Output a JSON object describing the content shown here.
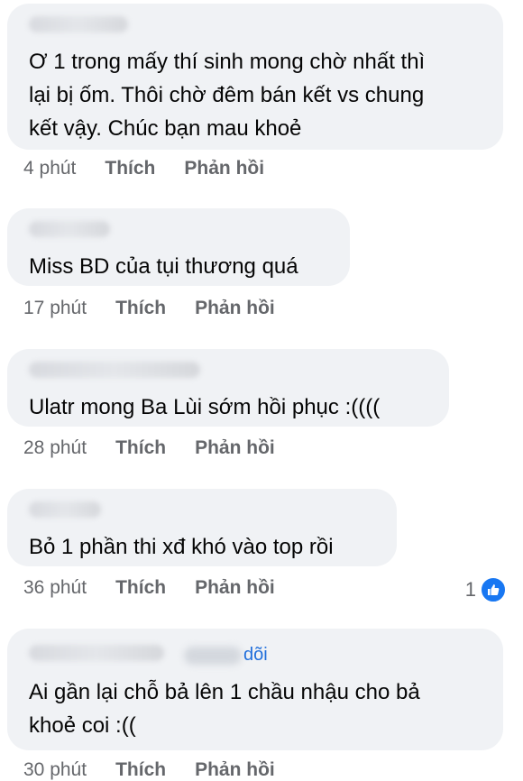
{
  "comments": [
    {
      "text": "Ơ 1 trong mấy thí sinh mong chờ nhất thì\nlại bị ốm. Thôi chờ đêm bán kết vs chung\nkết vậy. Chúc bạn mau khoẻ",
      "time": "4 phút",
      "like_label": "Thích",
      "reply_label": "Phản hồi"
    },
    {
      "text": "Miss BD của tụi thương quá",
      "time": "17 phút",
      "like_label": "Thích",
      "reply_label": "Phản hồi"
    },
    {
      "text": "Ulatr mong Ba Lùi sớm hồi phục :((((",
      "time": "28 phút",
      "like_label": "Thích",
      "reply_label": "Phản hồi"
    },
    {
      "text": "Bỏ 1 phần thi xđ khó vào top rồi",
      "time": "36 phút",
      "like_label": "Thích",
      "reply_label": "Phản hồi",
      "reaction_count": "1"
    },
    {
      "follow_text": "dõi",
      "text": "Ai gần lại chỗ bả lên 1 chầu nhậu cho bả\nkhoẻ coi :((",
      "time": "30 phút",
      "like_label": "Thích",
      "reply_label": "Phản hồi"
    }
  ],
  "colors": {
    "bubble": "#f0f2f5",
    "meta": "#65676b",
    "like_blue": "#1877f2",
    "follow_blue": "#216fdb"
  },
  "icons": {
    "reaction": "like-thumb-icon"
  }
}
